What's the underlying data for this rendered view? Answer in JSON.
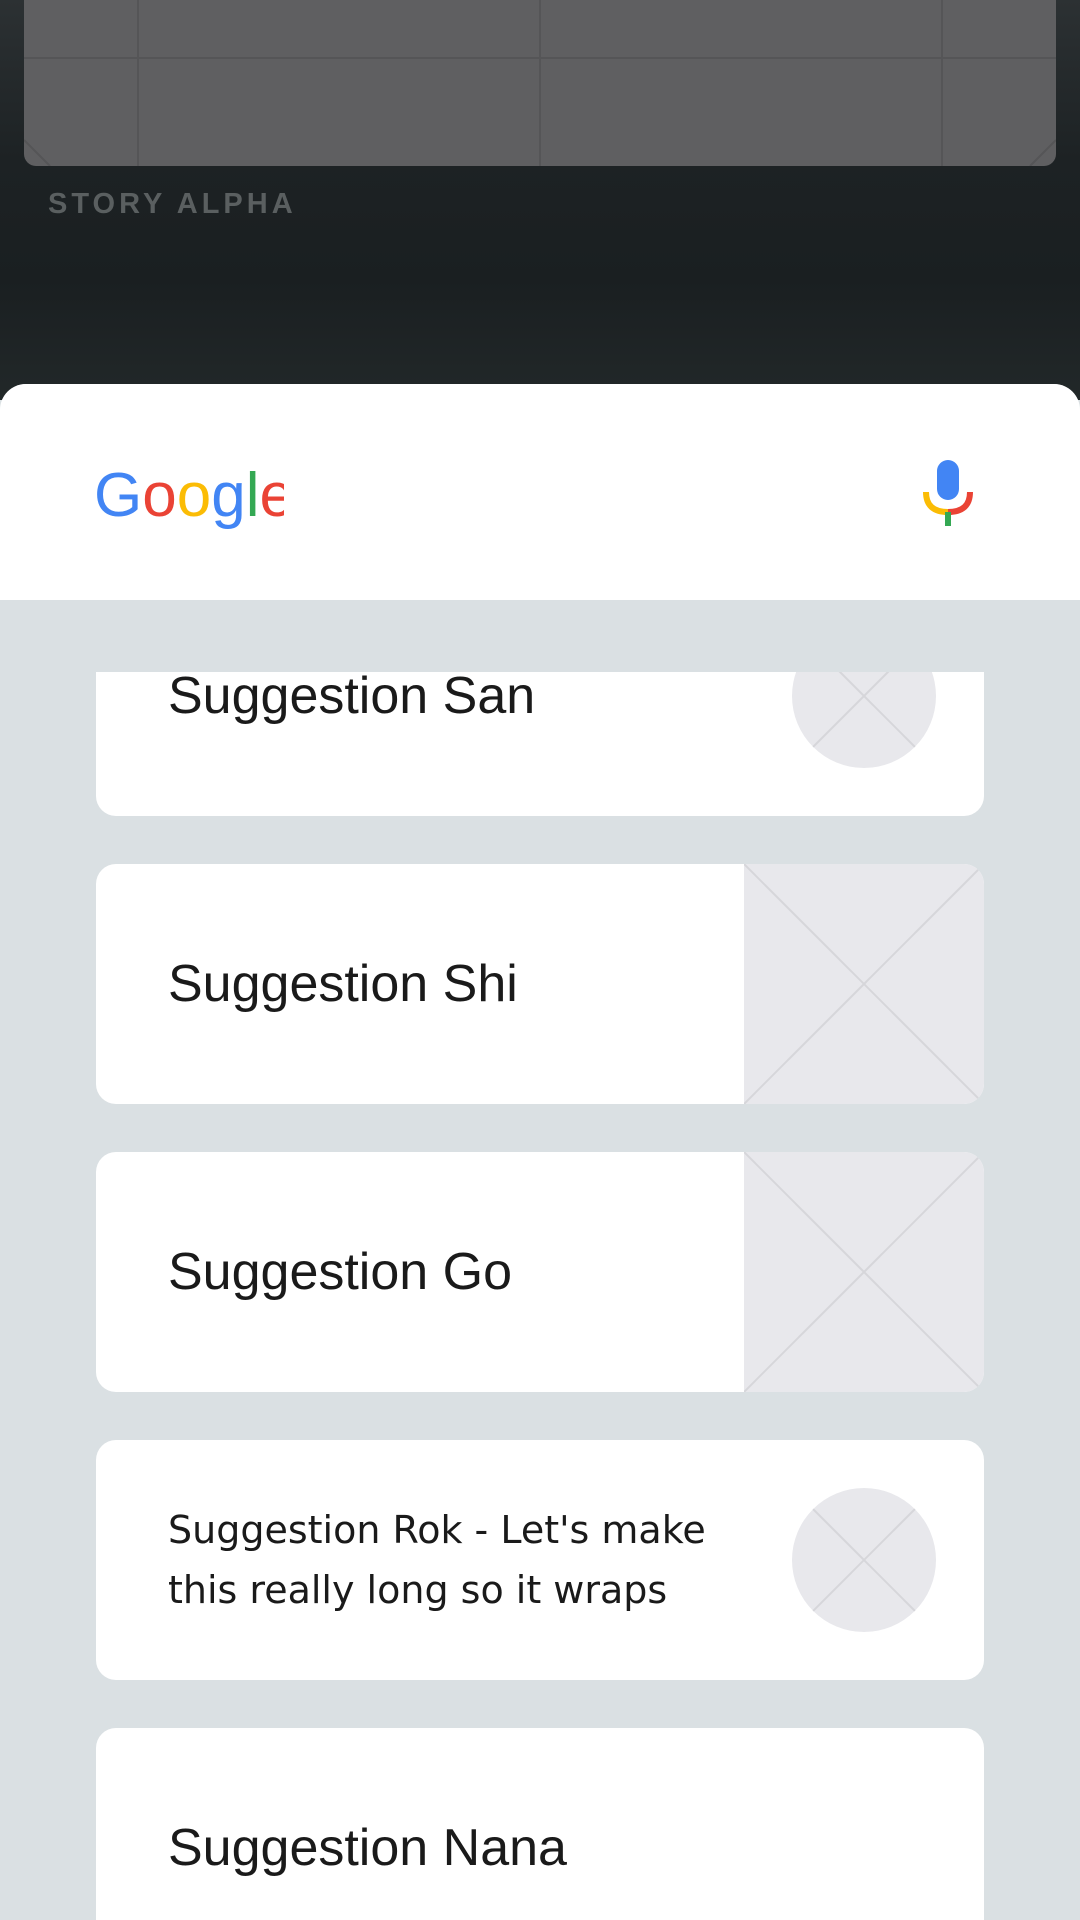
{
  "story": {
    "label": "STORY ALPHA"
  },
  "search": {
    "logo_text": "Google",
    "mic_icon": "microphone-icon"
  },
  "suggestions": [
    {
      "text": "Suggestion San",
      "thumbnail": "circle"
    },
    {
      "text": "Suggestion Shi",
      "thumbnail": "square"
    },
    {
      "text": "Suggestion Go",
      "thumbnail": "square"
    },
    {
      "text": "Suggestion Rok - Let's make this really long so it wraps",
      "thumbnail": "circle"
    },
    {
      "text": "Suggestion Nana",
      "thumbnail": "none"
    }
  ],
  "colors": {
    "sheet_background": "#dae0e3",
    "card_background": "#ffffff",
    "thumbnail_placeholder": "#e8e8ec",
    "google_blue": "#4285F4",
    "google_red": "#EA4335",
    "google_yellow": "#FBBC05",
    "google_green": "#34A853"
  }
}
